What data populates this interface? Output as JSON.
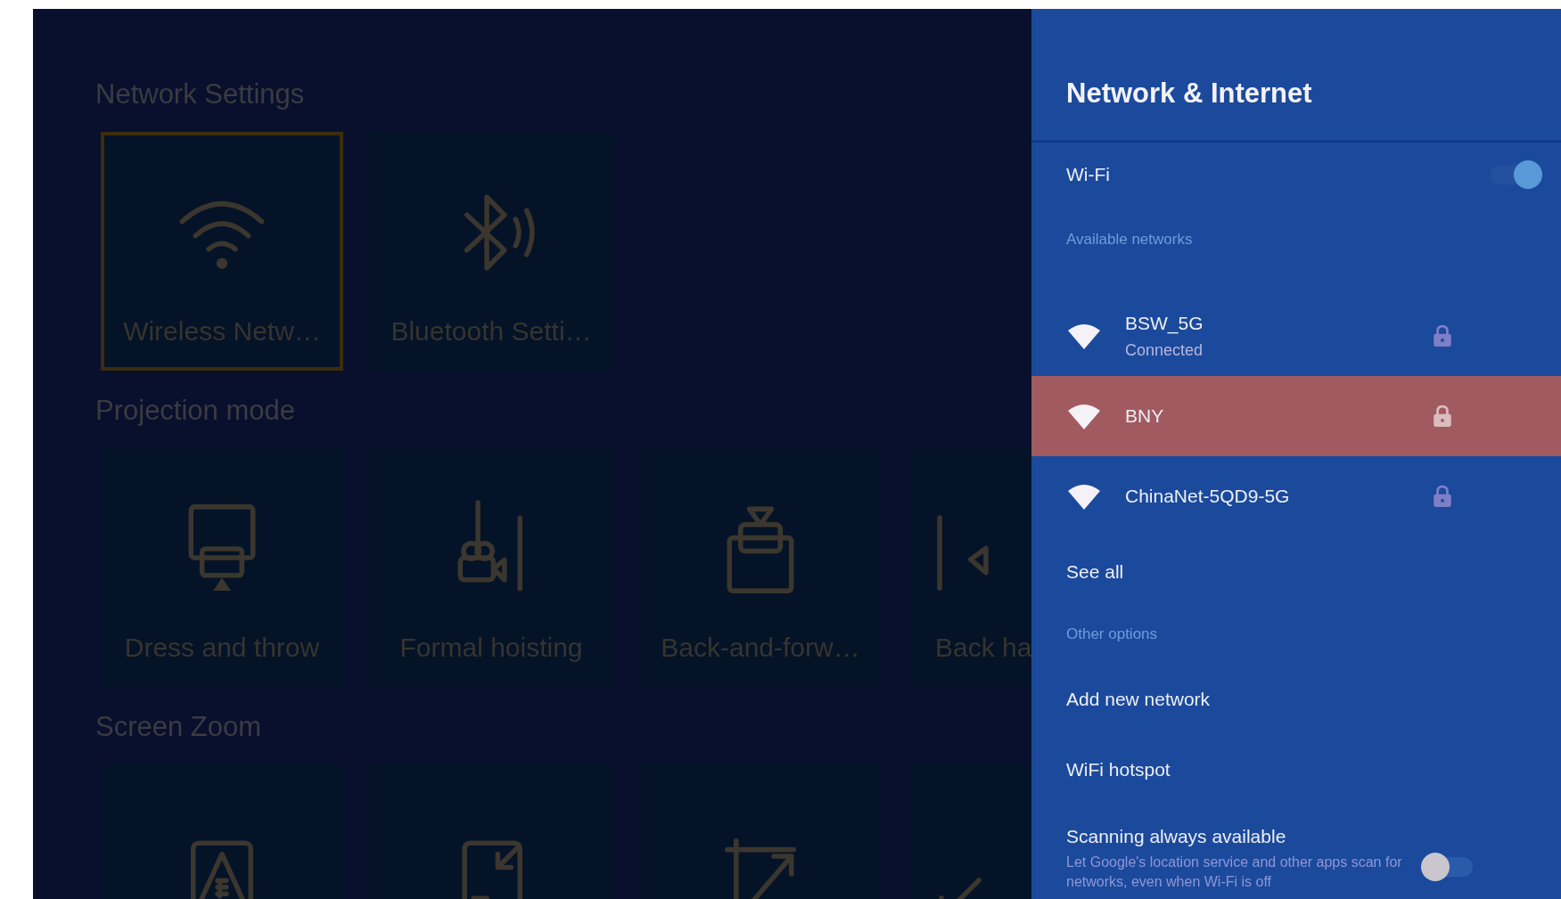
{
  "settings": {
    "sections": [
      {
        "title": "Network Settings",
        "tiles": [
          {
            "label": "Wireless Netw…",
            "kind": "wifi",
            "selected": true,
            "cut": false
          },
          {
            "label": "Bluetooth Setti…",
            "kind": "bluetooth",
            "selected": false,
            "cut": false
          }
        ]
      },
      {
        "title": "Projection mode",
        "tiles": [
          {
            "label": "Dress and throw",
            "kind": "projection",
            "selected": false,
            "cut": false
          },
          {
            "label": "Formal hoisting",
            "kind": "hoisting",
            "selected": false,
            "cut": false
          },
          {
            "label": "Back-and-forw…",
            "kind": "tray",
            "selected": false,
            "cut": false
          },
          {
            "label": "Back ha",
            "kind": "rear",
            "selected": false,
            "cut": true
          }
        ]
      },
      {
        "title": "Screen Zoom",
        "tiles": [
          {
            "kind": "warning",
            "selected": false,
            "cut": false
          },
          {
            "kind": "shrink",
            "selected": false,
            "cut": false
          },
          {
            "kind": "expand",
            "selected": false,
            "cut": false
          },
          {
            "kind": "corner",
            "selected": false,
            "cut": true
          }
        ]
      }
    ]
  },
  "panel": {
    "title": "Network & Internet",
    "wifi": {
      "label": "Wi-Fi",
      "on": true
    },
    "available_label": "Available networks",
    "networks": [
      {
        "name": "BSW_5G",
        "status": "Connected",
        "locked": true,
        "selected": false
      },
      {
        "name": "BNY",
        "locked": true,
        "selected": true
      },
      {
        "name": "ChinaNet-5QD9-5G",
        "locked": true,
        "selected": false
      }
    ],
    "see_all": "See all",
    "other_label": "Other options",
    "options": [
      "Add new network",
      "WiFi hotspot"
    ],
    "scanning": {
      "title": "Scanning always available",
      "description": "Let Google's location service and other apps scan for networks, even when Wi-Fi is off",
      "on": false
    }
  }
}
